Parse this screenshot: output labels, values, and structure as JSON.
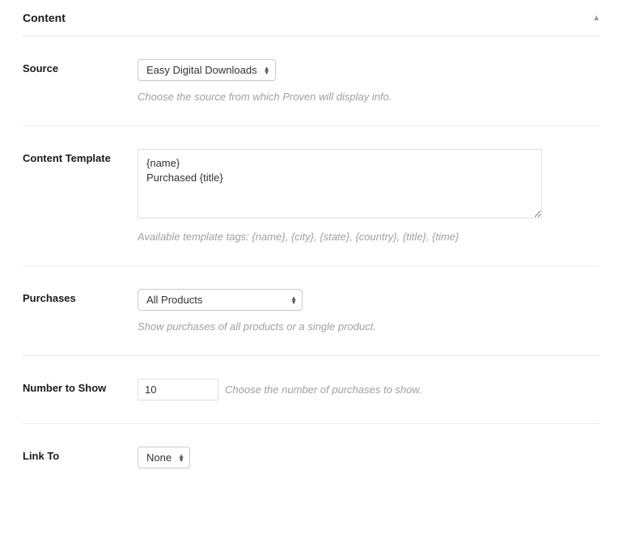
{
  "panel": {
    "title": "Content"
  },
  "fields": {
    "source": {
      "label": "Source",
      "value": "Easy Digital Downloads",
      "helper": "Choose the source from which Proven will display info."
    },
    "content_template": {
      "label": "Content Template",
      "value": "{name}\nPurchased {title}",
      "helper": "Available template tags: {name}, {city}, {state}, {country}, {title}, {time}"
    },
    "purchases": {
      "label": "Purchases",
      "value": "All Products",
      "helper": "Show purchases of all products or a single product."
    },
    "number_to_show": {
      "label": "Number to Show",
      "value": "10",
      "helper": "Choose the number of purchases to show."
    },
    "link_to": {
      "label": "Link To",
      "value": "None"
    }
  }
}
